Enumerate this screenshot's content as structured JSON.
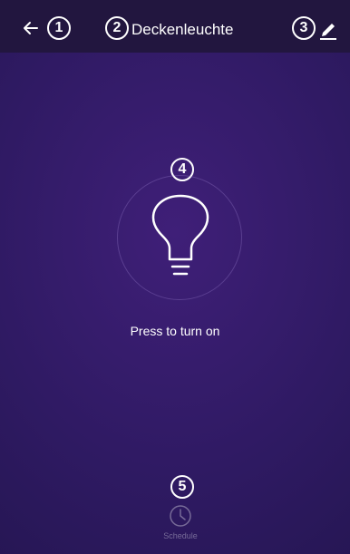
{
  "header": {
    "title": "Deckenleuchte",
    "back_icon": "arrow-left-icon",
    "edit_icon": "pencil-icon"
  },
  "annotations": [
    "1",
    "2",
    "3",
    "4",
    "5"
  ],
  "main": {
    "bulb_icon": "lightbulb-icon",
    "power_hint": "Press to turn on"
  },
  "footer": {
    "schedule_label": "Schedule",
    "schedule_icon": "clock-icon"
  },
  "colors": {
    "header_bg": "#22163f",
    "background": "#2f1a63",
    "text": "#ffffff",
    "muted": "#776b98",
    "ring": "#af96e1"
  }
}
